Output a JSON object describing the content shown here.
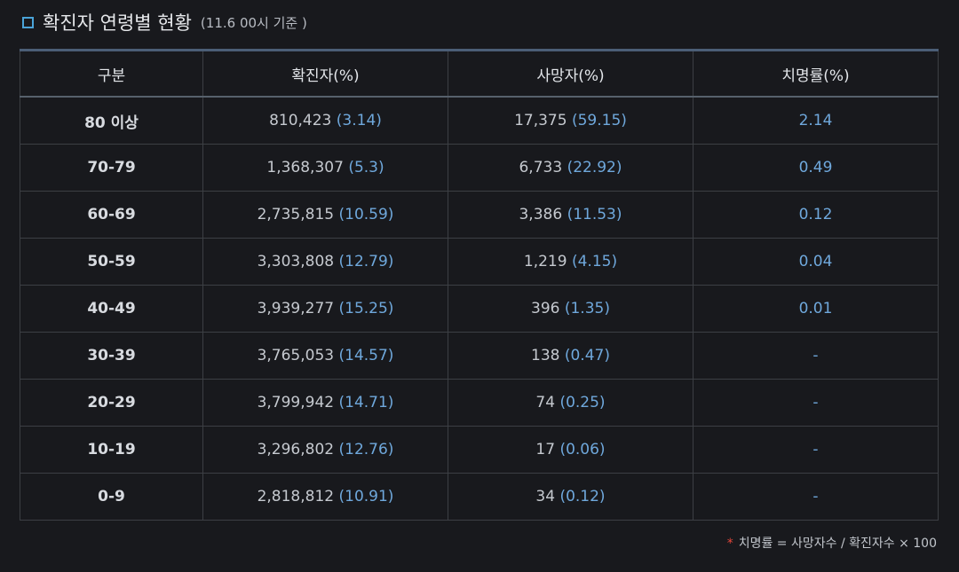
{
  "header": {
    "title": "확진자 연령별 현황",
    "subtitle": "(11.6 00시 기준 )"
  },
  "table": {
    "columns": [
      "구분",
      "확진자(%)",
      "사망자(%)",
      "치명률(%)"
    ],
    "rows": [
      {
        "group": "80 이상",
        "cases": "810,423",
        "cases_pct": "(3.14)",
        "deaths": "17,375",
        "deaths_pct": "(59.15)",
        "fatality": "2.14"
      },
      {
        "group": "70-79",
        "cases": "1,368,307",
        "cases_pct": "(5.3)",
        "deaths": "6,733",
        "deaths_pct": "(22.92)",
        "fatality": "0.49"
      },
      {
        "group": "60-69",
        "cases": "2,735,815",
        "cases_pct": "(10.59)",
        "deaths": "3,386",
        "deaths_pct": "(11.53)",
        "fatality": "0.12"
      },
      {
        "group": "50-59",
        "cases": "3,303,808",
        "cases_pct": "(12.79)",
        "deaths": "1,219",
        "deaths_pct": "(4.15)",
        "fatality": "0.04"
      },
      {
        "group": "40-49",
        "cases": "3,939,277",
        "cases_pct": "(15.25)",
        "deaths": "396",
        "deaths_pct": "(1.35)",
        "fatality": "0.01"
      },
      {
        "group": "30-39",
        "cases": "3,765,053",
        "cases_pct": "(14.57)",
        "deaths": "138",
        "deaths_pct": "(0.47)",
        "fatality": "-"
      },
      {
        "group": "20-29",
        "cases": "3,799,942",
        "cases_pct": "(14.71)",
        "deaths": "74",
        "deaths_pct": "(0.25)",
        "fatality": "-"
      },
      {
        "group": "10-19",
        "cases": "3,296,802",
        "cases_pct": "(12.76)",
        "deaths": "17",
        "deaths_pct": "(0.06)",
        "fatality": "-"
      },
      {
        "group": "0-9",
        "cases": "2,818,812",
        "cases_pct": "(10.91)",
        "deaths": "34",
        "deaths_pct": "(0.12)",
        "fatality": "-"
      }
    ]
  },
  "footnote": {
    "marker": "*",
    "text": "치명률 = 사망자수 / 확진자수 × 100"
  },
  "colors": {
    "background": "#18191d",
    "accent": "#4aa3d8",
    "percent_text": "#6fa8dc",
    "footnote_marker": "#e5473a"
  }
}
